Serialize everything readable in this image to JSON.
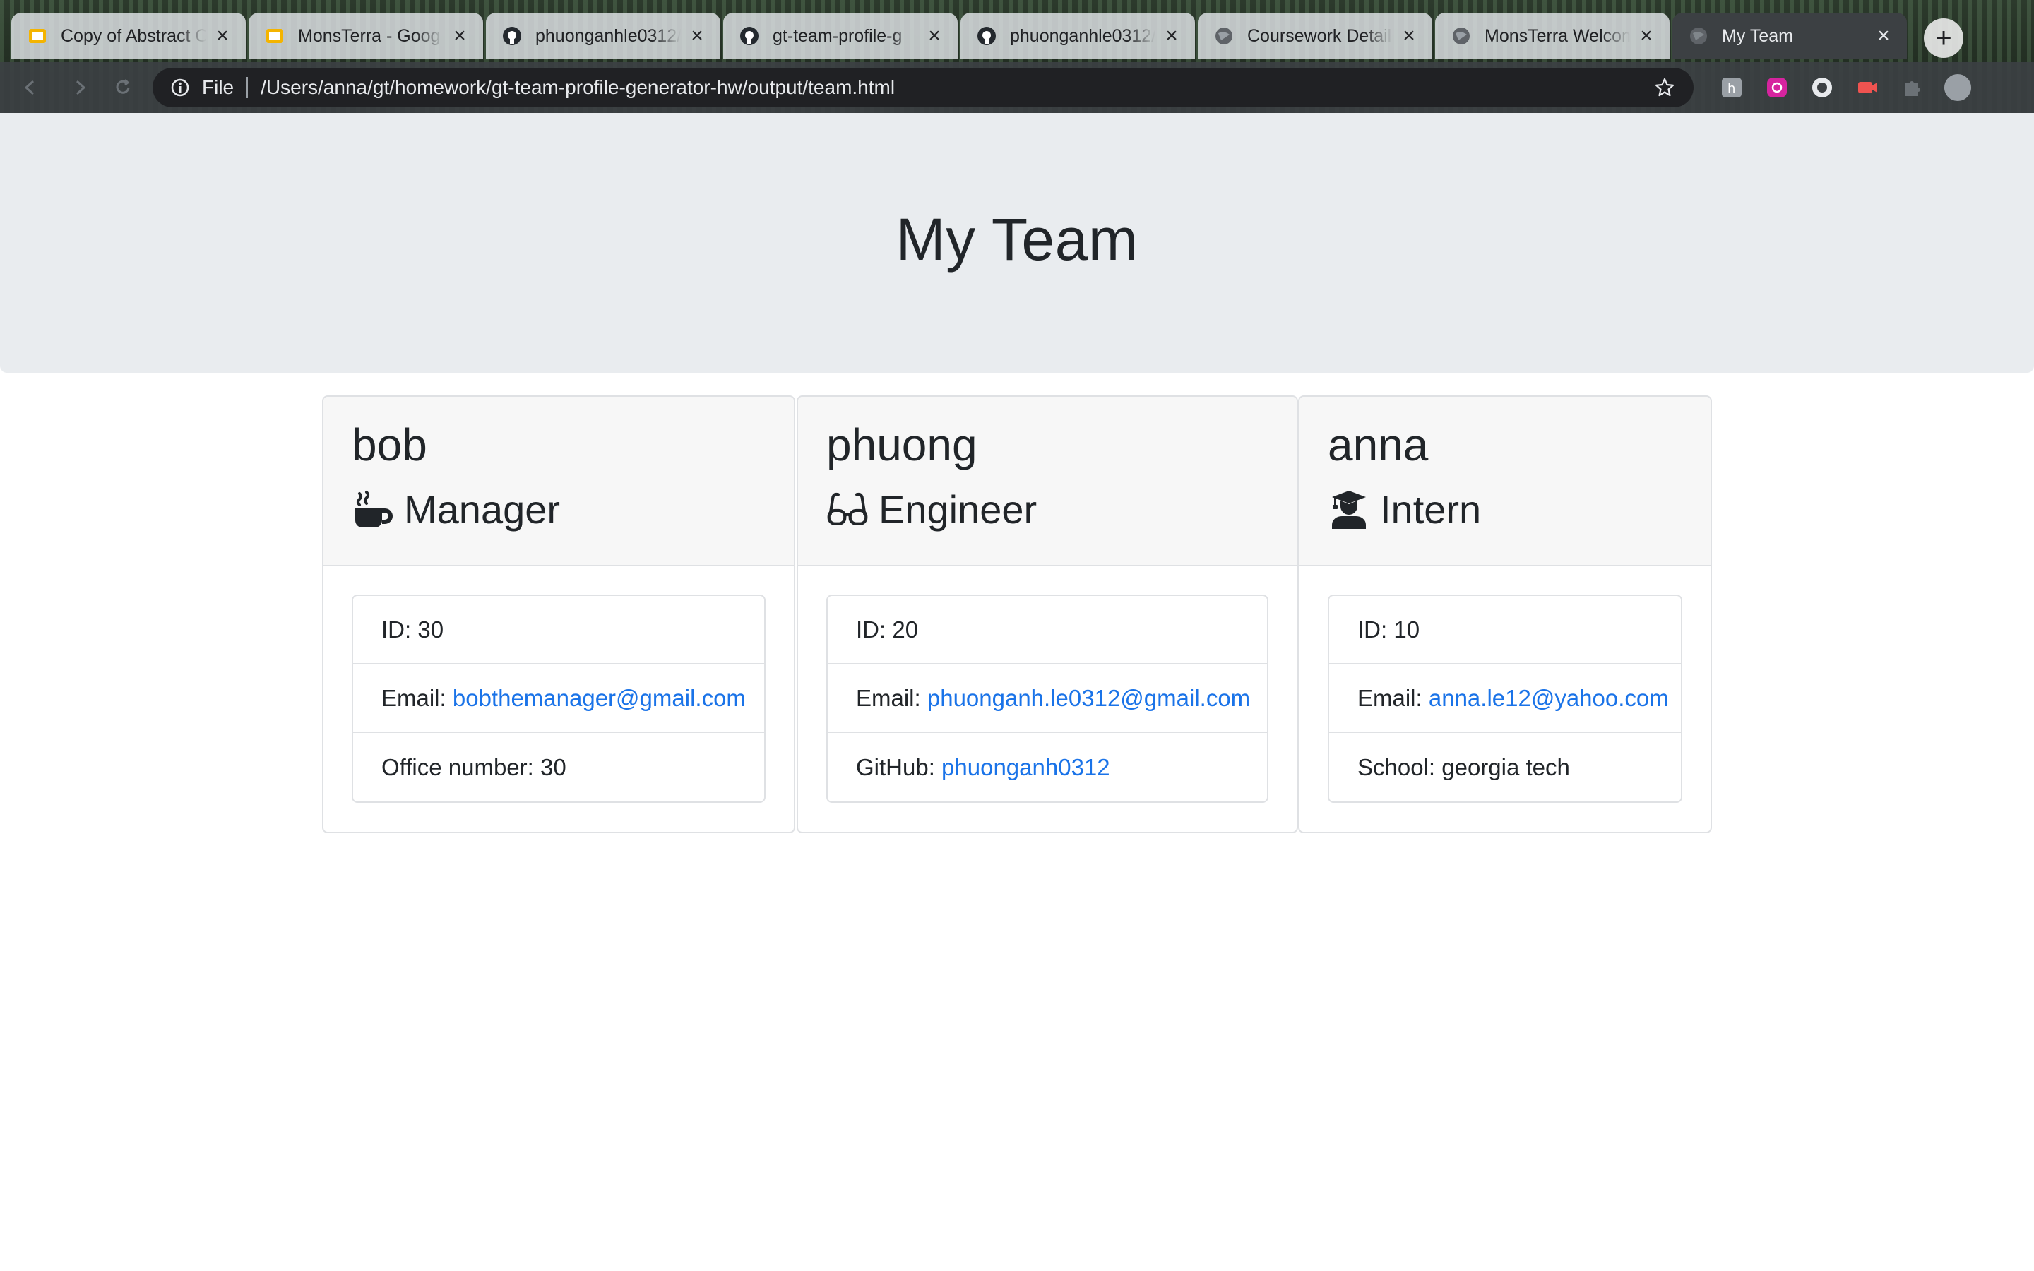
{
  "browser": {
    "tabs": [
      {
        "title": "Copy of Abstract C",
        "icon": "slides-icon"
      },
      {
        "title": "MonsTerra - Goog",
        "icon": "slides-icon"
      },
      {
        "title": "phuonganhle0312/",
        "icon": "github-icon"
      },
      {
        "title": "gt-team-profile-g",
        "icon": "github-icon"
      },
      {
        "title": "phuonganhle0312/",
        "icon": "github-icon"
      },
      {
        "title": "Coursework Detail",
        "icon": "globe-icon"
      },
      {
        "title": "MonsTerra Welcom",
        "icon": "globe-icon"
      },
      {
        "title": "My Team",
        "icon": "globe-icon"
      }
    ],
    "active_tab": 7,
    "address": {
      "scheme": "File",
      "url": "/Users/anna/gt/homework/gt-team-profile-generator-hw/output/team.html"
    }
  },
  "page": {
    "title": "My Team",
    "employees": [
      {
        "name": "bob",
        "role": "Manager",
        "icon": "coffee-mug-icon",
        "id_label": "ID: 30",
        "email_prefix": "Email: ",
        "email": "bobthemanager@gmail.com",
        "extra_prefix": "Office number: ",
        "extra_value": "30"
      },
      {
        "name": "phuong",
        "role": "Engineer",
        "icon": "glasses-icon",
        "id_label": "ID: 20",
        "email_prefix": "Email: ",
        "email": "phuonganh.le0312@gmail.com",
        "extra_prefix": "GitHub: ",
        "extra_value": "phuonganh0312"
      },
      {
        "name": "anna",
        "role": "Intern",
        "icon": "graduate-icon",
        "id_label": "ID: 10",
        "email_prefix": "Email: ",
        "email": "anna.le12@yahoo.com",
        "extra_prefix": "School: ",
        "extra_value": "georgia tech"
      }
    ]
  },
  "colors": {
    "jumbotron": "#e9ecef",
    "link": "#1a73e8",
    "text": "#212529"
  }
}
